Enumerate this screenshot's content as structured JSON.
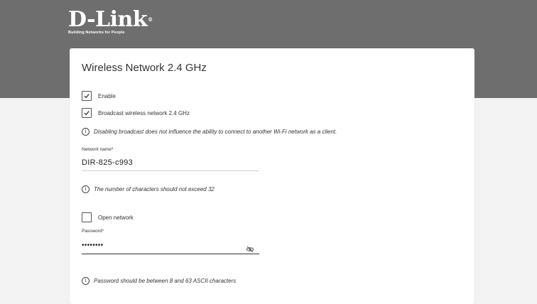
{
  "brand": {
    "name": "D-Link",
    "tm": "®",
    "tagline": "Building Networks for People"
  },
  "section": {
    "title": "Wireless Network 2.4 GHz"
  },
  "checkboxes": {
    "enable": {
      "label": "Enable",
      "checked": true
    },
    "broadcast": {
      "label": "Broadcast wireless network 2.4 GHz",
      "checked": true
    },
    "open_network": {
      "label": "Open network",
      "checked": false
    }
  },
  "hints": {
    "broadcast": "Disabling broadcast does not influence the ability to connect to another Wi-Fi network as a client.",
    "name_length": "The number of characters should not exceed 32",
    "password_length": "Password should be between 8 and 63 ASCII characters"
  },
  "network_name": {
    "label": "Network name*",
    "value": "DIR-825-c993"
  },
  "password": {
    "label": "Password*",
    "value": "••••••••",
    "visibility_icon": "eye-off-icon"
  },
  "colors": {
    "header": "#6e6e6e",
    "background": "#f3f3f3",
    "card": "#ffffff"
  }
}
